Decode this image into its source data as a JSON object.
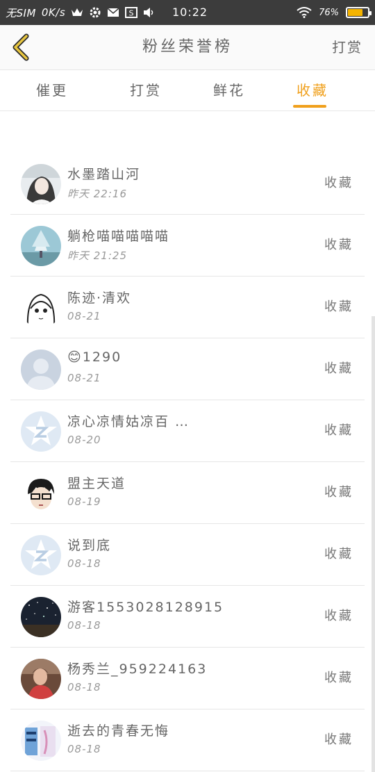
{
  "status_bar": {
    "carrier": "无SIM",
    "speed": "0K/s",
    "time": "10:22",
    "battery": "76%",
    "battery_level": 0.76,
    "icons": [
      "crown-icon",
      "gear-icon",
      "mail-icon",
      "s-app-icon",
      "speaker-icon",
      "wifi-icon",
      "battery-icon"
    ]
  },
  "header": {
    "back_icon": "chevron-left-icon",
    "title": "粉丝荣誉榜",
    "action_label": "打赏"
  },
  "tabs": [
    {
      "label": "催更",
      "active": false
    },
    {
      "label": "打赏",
      "active": false
    },
    {
      "label": "鲜花",
      "active": false
    },
    {
      "label": "收藏",
      "active": true
    }
  ],
  "colors": {
    "accent": "#f0a01c",
    "status_bar": "#3c3c3c"
  },
  "list": [
    {
      "name": "水墨踏山河",
      "time": "昨天 22:16",
      "action": "收藏",
      "avatar": "avatar-photo-girl"
    },
    {
      "name": "躺枪喵喵喵喵喵",
      "time": "昨天 21:25",
      "action": "收藏",
      "avatar": "avatar-photo-tree"
    },
    {
      "name": "陈迹·清欢",
      "time": "08-21",
      "action": "收藏",
      "avatar": "avatar-sketch-girl"
    },
    {
      "name": "😊1290",
      "time": "08-21",
      "action": "收藏",
      "avatar": "avatar-default-person"
    },
    {
      "name": "凉心凉情姑凉百 …",
      "time": "08-20",
      "action": "收藏",
      "avatar": "avatar-default-star"
    },
    {
      "name": "盟主天道",
      "time": "08-19",
      "action": "收藏",
      "avatar": "avatar-cartoon-glasses"
    },
    {
      "name": "说到底",
      "time": "08-18",
      "action": "收藏",
      "avatar": "avatar-default-star"
    },
    {
      "name": "游客1553028128915",
      "time": "08-18",
      "action": "收藏",
      "avatar": "avatar-photo-stars"
    },
    {
      "name": "杨秀兰_959224163",
      "time": "08-18",
      "action": "收藏",
      "avatar": "avatar-photo-woman"
    },
    {
      "name": "逝去的青春无悔",
      "time": "08-18",
      "action": "收藏",
      "avatar": "avatar-photo-poster"
    }
  ]
}
